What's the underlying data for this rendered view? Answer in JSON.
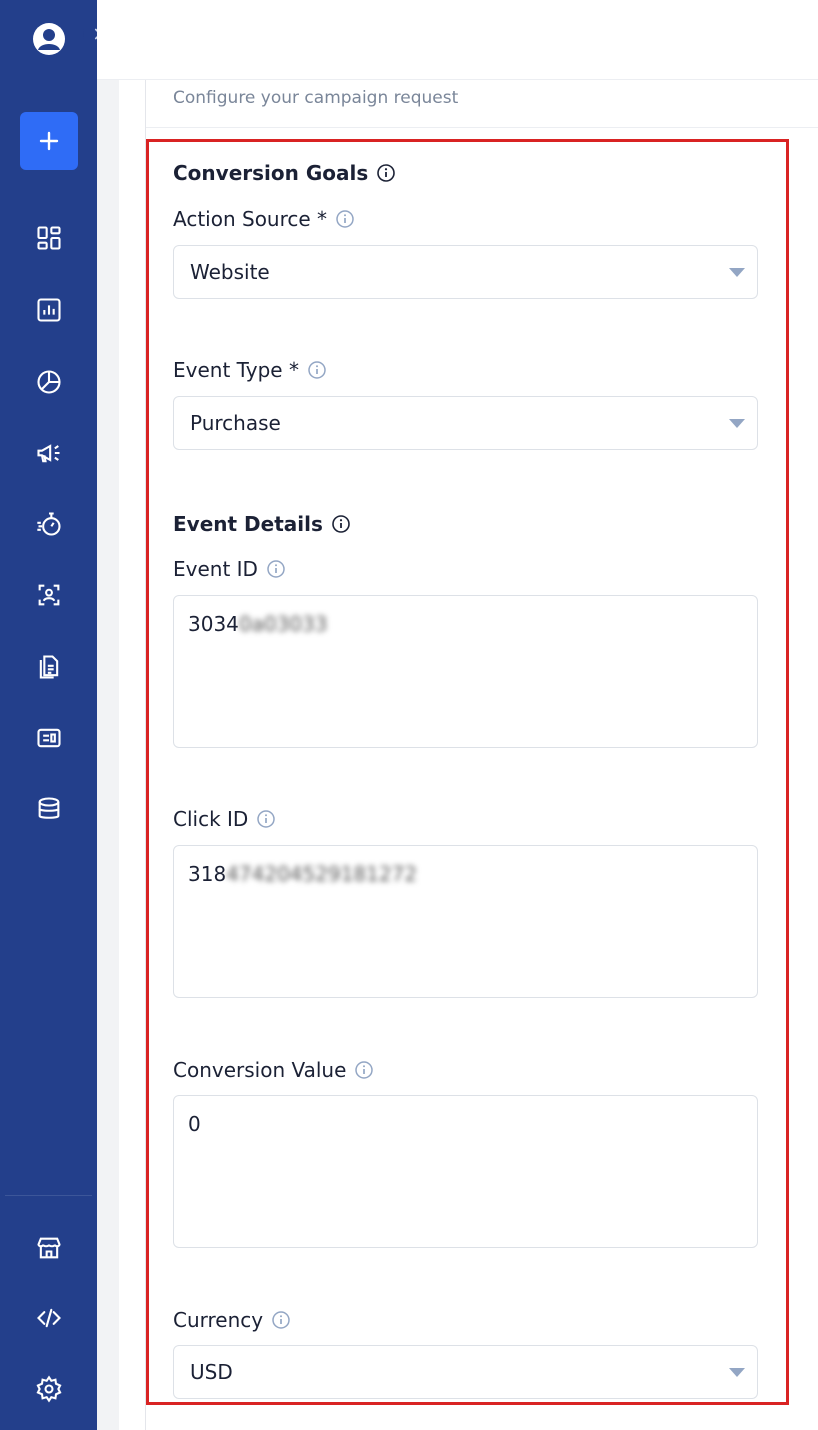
{
  "sidebar": {
    "icons": [
      "user-avatar-icon",
      "expand-chevron-icon",
      "plus-icon",
      "dashboard-icon",
      "bar-chart-icon",
      "pie-chart-icon",
      "megaphone-icon",
      "stopwatch-icon",
      "contact-card-icon",
      "documents-icon",
      "news-card-icon",
      "database-icon",
      "store-icon",
      "code-icon",
      "gear-icon"
    ]
  },
  "header": {
    "subtitle": "Configure your campaign request"
  },
  "form": {
    "conversion_goals_title": "Conversion Goals",
    "action_source": {
      "label": "Action Source *",
      "value": "Website"
    },
    "event_type": {
      "label": "Event Type *",
      "value": "Purchase"
    },
    "event_details_title": "Event Details",
    "event_id": {
      "label": "Event ID",
      "value_visible": "3034",
      "value_hidden": "0a03033"
    },
    "click_id": {
      "label": "Click ID",
      "value_visible": "318",
      "value_hidden": "474204529181272"
    },
    "conversion_value": {
      "label": "Conversion Value",
      "value": "0"
    },
    "currency": {
      "label": "Currency",
      "value": "USD"
    }
  },
  "colors": {
    "sidebar": "#233f8b",
    "primary_button": "#2f6cf6",
    "highlight_border": "#d92323",
    "caret": "#93a6c4"
  }
}
